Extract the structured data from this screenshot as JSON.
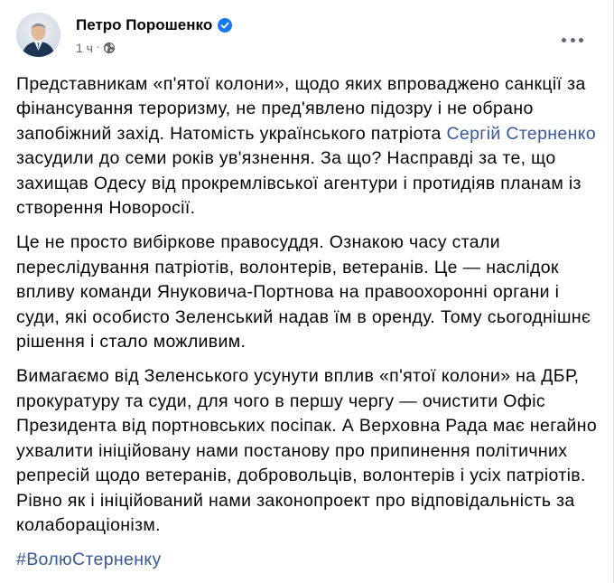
{
  "post": {
    "author": "Петро Порошенко",
    "verified_icon": "verified-badge-icon",
    "time": "1 ч",
    "separator": "·",
    "privacy_icon": "globe-icon",
    "more_icon": "more-options-icon",
    "paragraphs": [
      {
        "before": "Представникам «п'ятої колони», щодо яких впроваджено санкції за фінансування тероризму, не пред'явлено підозру і не обрано запобіжний захід. Натомість українського патріота ",
        "link": "Сергій Стерненко",
        "after": " засудили до семи років ув'язнення. За що? Насправді за те, що захищав Одесу від прокремлівської агентури і протидіяв планам із створення Новоросії."
      },
      {
        "text": "Це не просто вибіркове правосуддя. Ознакою часу стали переслідування патріотів, волонтерів, ветеранів. Це — наслідок впливу команди Януковича-Портнова на правоохоронні органи і суди, які особисто Зеленський надав їм в оренду. Тому сьогоднішнє рішення і стало можливим."
      },
      {
        "text": "Вимагаємо від Зеленського усунути вплив «п'ятої колони» на ДБР, прокуратуру та суди, для чого в першу чергу — очистити Офіс Президента від портновських посіпак. А Верховна Рада має негайно ухвалити ініційовану нами постанову про припинення політичних репресій щодо ветеранів, добровольців, волонтерів і усіх патріотів. Рівно як і ініційований нами законопроект про відповідальність за колабораціонізм."
      }
    ],
    "hashtag": "#ВолюСтерненку",
    "colors": {
      "link": "#385898",
      "meta": "#65676b",
      "verified": "#1877f2",
      "text": "#050505"
    }
  }
}
